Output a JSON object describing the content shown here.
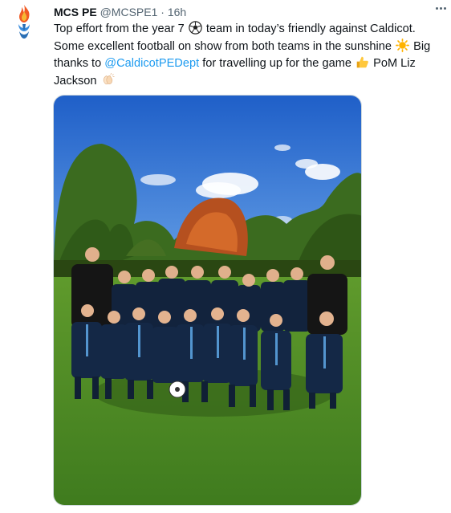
{
  "tweet": {
    "author_name": "MCS PE",
    "author_handle": "@MCSPE1",
    "separator": "·",
    "time": "16h",
    "text_part1": "Top effort from the year 7",
    "text_part2": "team in today’s friendly against Caldicot. Some excellent football on show from both teams in the sunshine",
    "text_part3": "Big thanks to",
    "mention": "@CaldicotPEDept",
    "text_part4": "for travelling up for the game",
    "text_part5": "PoM Liz Jackson",
    "emojis": [
      "soccer-ball",
      "sun",
      "thumbs-up",
      "clapping-hands"
    ]
  },
  "colors": {
    "link": "#1d9bf0",
    "secondary_text": "#536471",
    "primary_text": "#0f1419",
    "border": "#cfd9de"
  },
  "media": {
    "type": "photo",
    "description_icon": "team-photo"
  }
}
